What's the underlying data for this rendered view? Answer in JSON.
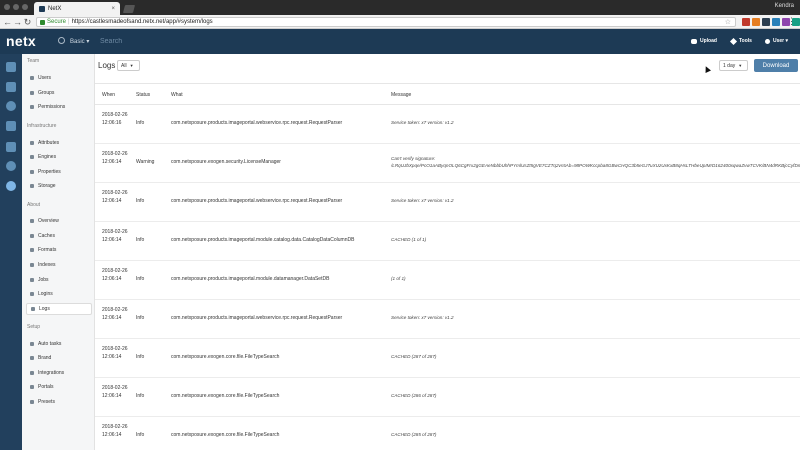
{
  "browser": {
    "tab_title": "NetX",
    "tab_close": "×",
    "profile_name": "Kendra",
    "url_secure": "Secure",
    "url_text": "https://castlesmadeofsand.netx.net/app/#system/logs",
    "back": "←",
    "forward": "→",
    "reload": "↻",
    "star": "☆",
    "menu": "⋮",
    "ext_colors": [
      "#c0392b",
      "#e67e22",
      "#2c3e50",
      "#2980b9",
      "#8e44ad",
      "#16a085"
    ]
  },
  "header": {
    "logo": "netx",
    "scope": "Basic ▾",
    "search_placeholder": "Search",
    "upload": "Upload",
    "tools": "Tools",
    "user": "User ▾"
  },
  "sidebar": {
    "team_title": "Team",
    "team": [
      "Users",
      "Groups",
      "Permissions"
    ],
    "infrastructure_title": "Infrastructure",
    "infrastructure": [
      "Attributes",
      "Engines",
      "Properties",
      "Storage"
    ],
    "about_title": "About",
    "about": [
      "Overview",
      "Caches",
      "Formats",
      "Indexes",
      "Jobs",
      "Logins",
      "Logs"
    ],
    "setup_title": "Setup",
    "setup": [
      "Auto tasks",
      "Brand",
      "Integrations",
      "Portals",
      "Presets"
    ]
  },
  "main": {
    "title": "Logs",
    "filter_value": "All",
    "range_value": "1 day",
    "download_label": "Download",
    "columns": {
      "when": "When",
      "status": "Status",
      "what": "What",
      "message": "Message"
    },
    "rows": [
      {
        "when": "2018-02-26 12:06:16",
        "status": "Info",
        "what": "com.netxposure.products.imageportal.webservice.rpc.request.RequestParser",
        "message": "Service token: x7 version: v1.2"
      },
      {
        "when": "2018-02-26 12:06:14",
        "status": "Warning",
        "what": "com.netxposure.exogen.security.LicenseManager",
        "message": "Can't verify signature:",
        "message2": "/LRqUJbXpqe/PcO1aAByqnOLQ6CgFrx2gGEAeNbbbUhhPYmlUsZt5gVE7CZTq2vs5Ab=98POWKccpba8GBwCHQC3b5eGJ7uXUzUxKxB8qHsLTHbeUpIMrD162400xqwaZvwTCVK/BN4dRKBjcCyfDn"
      },
      {
        "when": "2018-02-26 12:06:14",
        "status": "Info",
        "what": "com.netxposure.products.imageportal.webservice.rpc.request.RequestParser",
        "message": "Service token: x7 version: v1.2"
      },
      {
        "when": "2018-02-26 12:06:14",
        "status": "Info",
        "what": "com.netxposure.products.imageportal.module.catalog.data.CatalogDataColumnDB",
        "message": "CACHED (1 of 1)"
      },
      {
        "when": "2018-02-26 12:06:14",
        "status": "Info",
        "what": "com.netxposure.products.imageportal.module.datamanager.DataSetDB",
        "message": "(1 of 1)"
      },
      {
        "when": "2018-02-26 12:06:14",
        "status": "Info",
        "what": "com.netxposure.products.imageportal.webservice.rpc.request.RequestParser",
        "message": "Service token: x7 version: v1.2"
      },
      {
        "when": "2018-02-26 12:06:14",
        "status": "Info",
        "what": "com.netxposure.exogen.core.file.FileTypeSearch",
        "message": "CACHED (287 of 287)"
      },
      {
        "when": "2018-02-26 12:06:14",
        "status": "Info",
        "what": "com.netxposure.exogen.core.file.FileTypeSearch",
        "message": "CACHED (286 of 287)"
      },
      {
        "when": "2018-02-26 12:06:14",
        "status": "Info",
        "what": "com.netxposure.exogen.core.file.FileTypeSearch",
        "message": "CACHED (285 of 287)"
      }
    ]
  }
}
